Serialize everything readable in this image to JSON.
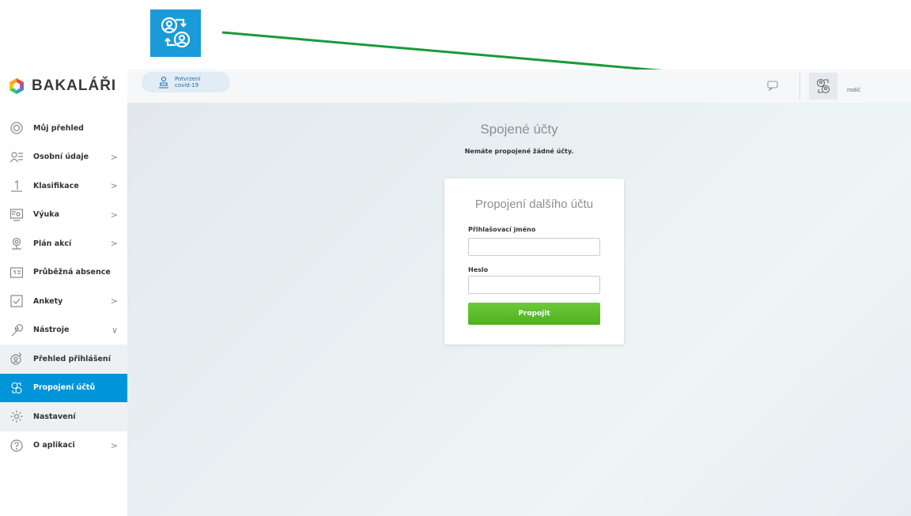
{
  "brand": {
    "name": "BAKALÁŘI"
  },
  "topbar": {
    "covid_line1": "Potvrzení",
    "covid_line2": "covid-19",
    "user_role": "rodič"
  },
  "sidebar": {
    "items": [
      {
        "label": "Můj přehled",
        "icon": "target-icon",
        "chevron": ""
      },
      {
        "label": "Osobní údaje",
        "icon": "person-card-icon",
        "chevron": ">"
      },
      {
        "label": "Klasifikace",
        "icon": "grade-one-icon",
        "chevron": ">"
      },
      {
        "label": "Výuka",
        "icon": "teaching-icon",
        "chevron": ">"
      },
      {
        "label": "Plán akcí",
        "icon": "map-pin-icon",
        "chevron": ">"
      },
      {
        "label": "Průběžná absence",
        "icon": "absence-icon",
        "chevron": ""
      },
      {
        "label": "Ankety",
        "icon": "checkbox-icon",
        "chevron": ">"
      },
      {
        "label": "Nástroje",
        "icon": "wrench-icon",
        "chevron": "∨"
      },
      {
        "label": "Přehled přihlášení",
        "icon": "login-overview-icon",
        "chevron": ""
      },
      {
        "label": "Propojení účtů",
        "icon": "linked-accounts-icon",
        "chevron": ""
      },
      {
        "label": "Nastavení",
        "icon": "gear-icon",
        "chevron": ""
      },
      {
        "label": "O aplikaci",
        "icon": "help-circle-icon",
        "chevron": ">"
      }
    ]
  },
  "main": {
    "title": "Spojené účty",
    "subtitle": "Nemáte propojené žádné účty.",
    "card": {
      "title": "Propojení dalšího účtu",
      "username_label": "Přihlašovací jméno",
      "username_value": "",
      "password_label": "Heslo",
      "password_value": "",
      "submit_label": "Propojit"
    }
  },
  "colors": {
    "accent": "#0095d9",
    "button_green": "#5cbd2b",
    "annotation_arrow": "#1a9a3a"
  }
}
